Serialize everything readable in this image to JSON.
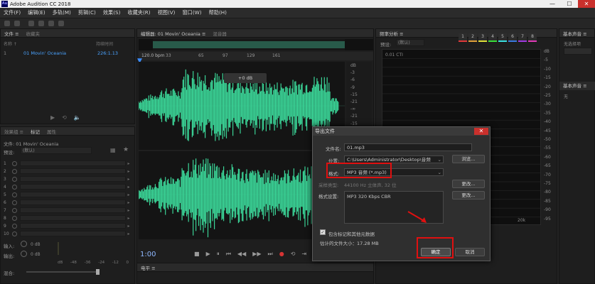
{
  "titlebar": {
    "app_icon": "Au",
    "title": "Adobe Audition CC 2018",
    "minimize": "—",
    "maximize": "☐",
    "close": "✕"
  },
  "menu": [
    "文件(F)",
    "编辑(E)",
    "多轨(M)",
    "剪辑(C)",
    "效果(S)",
    "收藏夹(R)",
    "视图(V)",
    "窗口(W)",
    "帮助(H)"
  ],
  "files_panel": {
    "tabs": [
      "文件 ≡",
      "收藏夹"
    ],
    "header": "名称 ↑",
    "header_right": "持续时间",
    "file": {
      "index": "1",
      "name": "01 Movin' Oceania",
      "duration": "226:1.13"
    }
  },
  "fx_panel": {
    "tabs": [
      "效果组 ≡",
      "标记",
      "属性"
    ],
    "title": "文件: 01 Movin' Oceania",
    "preset_label": "预设:",
    "preset_value": "(默认)",
    "slots": [
      "1",
      "2",
      "3",
      "4",
      "5",
      "6",
      "7",
      "8",
      "9",
      "10"
    ],
    "input_label": "输入:",
    "output_label": "输出:",
    "input_value": "0 dB",
    "output_value": "0 dB",
    "mix_label": "混合:",
    "meter_ticks": [
      "dB",
      "-48",
      "-36",
      "-24",
      "-12",
      "0"
    ]
  },
  "editor": {
    "tabs": [
      "编辑器: 01 Movin' Oceania ≡",
      "混音器"
    ],
    "bpm": "120.0 bpm",
    "ruler": [
      "33",
      "65",
      "97",
      "129",
      "161"
    ],
    "hud_gain": "+0 dB",
    "db_scale_top": [
      "dB",
      "-3",
      "-6",
      "-9",
      "-15",
      "-21",
      "-∞",
      "-21",
      "-15",
      "-9",
      "-6",
      "-3"
    ],
    "db_scale_bottom": [
      "dB",
      "-3",
      "-6",
      "-9",
      "-15",
      "-21",
      "-∞",
      "-21",
      "-15",
      "-9",
      "-6",
      "-3"
    ],
    "time": "1:00",
    "transport": [
      "■",
      "▶",
      "⏸",
      "⏮",
      "◀◀",
      "▶▶",
      "⏭",
      "●",
      "⟲",
      "⇥"
    ]
  },
  "mixer": {
    "tab": "电平 ≡"
  },
  "freq_panel": {
    "tab": "频率分析 ≡",
    "preset_label": "预设:",
    "preset_value": "(默认)",
    "chips": [
      "1",
      "2",
      "3",
      "4",
      "5",
      "6",
      "7",
      "8"
    ],
    "chip_colors": [
      "#e03a3a",
      "#e0a03a",
      "#e0e03a",
      "#3ae03a",
      "#3ae0e0",
      "#3a7ae0",
      "#a03ae0",
      "#e03ab8"
    ],
    "graph_label": "0.01 CTI",
    "db_scale": [
      "dB",
      "-5",
      "-10",
      "-15",
      "-20",
      "-25",
      "-30",
      "-35",
      "-40",
      "-45",
      "-50",
      "-55",
      "-60",
      "-65",
      "-70",
      "-75",
      "-80",
      "-85",
      "-90",
      "-95"
    ],
    "x_label": "20k"
  },
  "props_panel": {
    "tabs": [
      "基本声音 ≡",
      "无选择项",
      "基本声音 ≡",
      "无"
    ]
  },
  "dialog": {
    "title": "导出文件",
    "close": "✕",
    "filename_label": "文件名:",
    "filename_value": "01.mp3",
    "location_label": "位置:",
    "location_value": "C:\\Users\\Administrator\\Desktop\\音频",
    "browse": "浏览...",
    "format_label": "格式:",
    "format_value": "MP3 音频 (*.mp3)",
    "sample_label": "采样类型:",
    "sample_value": "44100 Hz 立体声, 32 位",
    "change1": "更改...",
    "settings_label": "格式设置:",
    "settings_value": "MP3 320 Kbps CBR",
    "change2": "更改...",
    "include_markers": "包含标记和其他元数据",
    "est_size": "估计的文件大小：17.28 MB",
    "ok": "确定",
    "cancel": "取消"
  }
}
